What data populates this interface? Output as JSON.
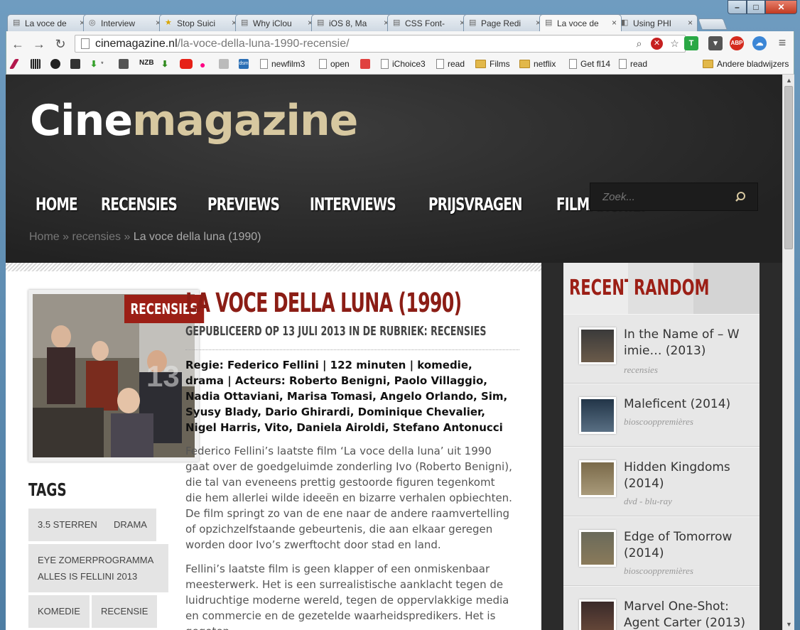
{
  "browser": {
    "window_controls": {
      "minimize": "–",
      "maximize": "□",
      "close": "✕"
    },
    "tabs": [
      {
        "title": "La voce de",
        "icon": "page-icon"
      },
      {
        "title": "Interview",
        "icon": "site-icon"
      },
      {
        "title": "Stop Suici",
        "icon": "star-icon"
      },
      {
        "title": "Why iClou",
        "icon": "page-icon"
      },
      {
        "title": "iOS 8, Ma",
        "icon": "page-icon"
      },
      {
        "title": "CSS Font-",
        "icon": "page-icon"
      },
      {
        "title": "Page Redi",
        "icon": "page-icon"
      },
      {
        "title": "La voce de",
        "icon": "page-icon",
        "active": true
      },
      {
        "title": "Using PHI",
        "icon": "site-icon"
      }
    ],
    "url_domain": "cinemagazine.nl",
    "url_path": "/la-voce-della-luna-1990-recensie/",
    "extensions": {
      "t": "T",
      "abp": "ABP"
    },
    "bookmarks": [
      {
        "label": "newfilm3",
        "type": "page"
      },
      {
        "label": "open",
        "type": "page"
      },
      {
        "label": "iChoice3",
        "type": "page"
      },
      {
        "label": "read",
        "type": "page"
      },
      {
        "label": "Films",
        "type": "folder"
      },
      {
        "label": "netflix",
        "type": "folder"
      },
      {
        "label": "Get fl14",
        "type": "page"
      },
      {
        "label": "read",
        "type": "page"
      }
    ],
    "bookmark_icons": {
      "nzb": "NZB",
      "dsm": "dsm"
    },
    "other_bookmarks": "Andere bladwijzers"
  },
  "site": {
    "logo_white": "Cine",
    "logo_gold": "magazine",
    "menu": [
      "HOME",
      "RECENSIES",
      "PREVIEWS",
      "INTERVIEWS",
      "PRIJSVRAGEN",
      "FILMARCHIEF"
    ],
    "search_placeholder": "Zoek...",
    "breadcrumb": {
      "home": "Home",
      "sep": "»",
      "section": "recensies",
      "current": "La voce della luna (1990)"
    }
  },
  "article": {
    "category": "RECENSIES",
    "title": "LA VOCE DELLA LUNA (1990)",
    "meta": "GEPUBLICEERD OP 13 JULI 2013 IN DE RUBRIEK: RECENSIES",
    "credits": "Regie: Federico Fellini | 122 minuten | komedie, drama | Acteurs: Roberto Benigni, Paolo Villaggio, Nadia Ottaviani, Marisa Tomasi, Angelo Orlando, Sim, Syusy Blady, Dario Ghirardi, Dominique Chevalier, Nigel Harris, Vito, Daniela Airoldi, Stefano Antonucci",
    "para1": "Federico Fellini’s laatste film ‘La voce della luna’ uit 1990 gaat over de goedgeluimde zonderling Ivo (Roberto Benigni), die tal van eveneens prettig gestoorde figuren tegenkomt die hem allerlei wilde ideeën en bizarre verhalen opbiechten. De film springt zo van de ene naar de andere raamvertelling of opzichzelfstaande gebeurtenis, die aan elkaar geregen worden door Ivo’s zwerftocht door stad en land.",
    "para2": "Fellini’s laatste film is geen klapper of een onmiskenbaar meesterwerk. Het is een surrealistische aanklacht tegen de luidruchtige moderne wereld, tegen de oppervlakkige media en commercie en de gezetelde waarheidspredikers. Het is gegoten",
    "tags_heading": "TAGS",
    "tags": [
      "3.5 STERREN",
      "DRAMA",
      "EYE ZOMERPROGRAMMA ALLES IS FELLINI 2013",
      "KOMEDIE",
      "RECENSIE"
    ]
  },
  "sidebar": {
    "tab_recent": "RECENT",
    "tab_random": "RANDOM",
    "items": [
      {
        "title": "In the Name of – W imie… (2013)",
        "category": "recensies"
      },
      {
        "title": "Maleficent (2014)",
        "category": "bioscooppremières"
      },
      {
        "title": "Hidden Kingdoms (2014)",
        "category": "dvd - blu-ray"
      },
      {
        "title": "Edge of Tomorrow (2014)",
        "category": "bioscooppremières"
      },
      {
        "title": "Marvel One-Shot: Agent Carter (2013)",
        "category": ""
      }
    ]
  },
  "colors": {
    "accent_red": "#9c1f16",
    "logo_gold": "#d7c8a0",
    "header_bg": "#2b2b2b"
  }
}
